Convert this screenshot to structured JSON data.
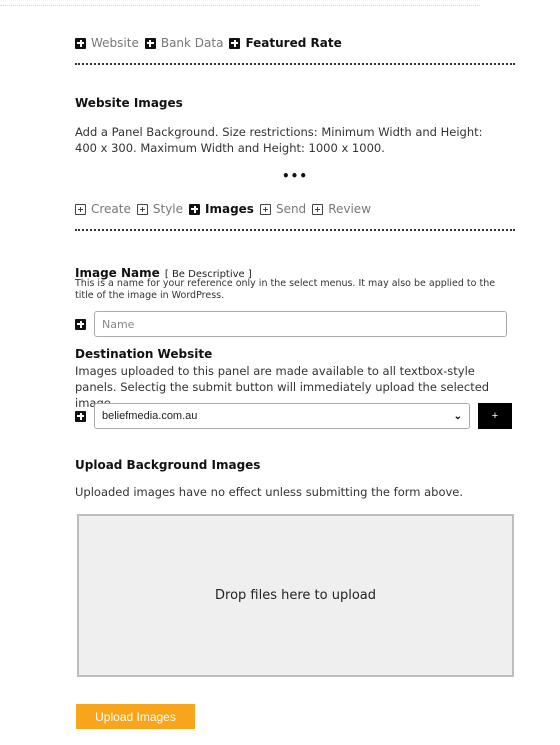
{
  "top_nav": {
    "items": [
      {
        "label": "Website",
        "active": false,
        "icon": "plus-square-solid-icon"
      },
      {
        "label": "Bank Data",
        "active": false,
        "icon": "plus-square-solid-icon"
      },
      {
        "label": "Featured Rate",
        "active": true,
        "icon": "plus-square-solid-icon"
      }
    ]
  },
  "website_images": {
    "title": "Website Images",
    "description": "Add a Panel Background. Size restrictions: Minimum Width and Height: 400 x 300. Maximum Width and Height: 1000 x 1000.",
    "more": "•••"
  },
  "step_nav": {
    "items": [
      {
        "label": "Create",
        "active": false,
        "icon": "plus-square-outline-icon"
      },
      {
        "label": "Style",
        "active": false,
        "icon": "plus-square-outline-icon"
      },
      {
        "label": "Images",
        "active": true,
        "icon": "plus-square-solid-icon"
      },
      {
        "label": "Send",
        "active": false,
        "icon": "plus-square-outline-icon"
      },
      {
        "label": "Review",
        "active": false,
        "icon": "plus-square-outline-icon"
      }
    ]
  },
  "image_name": {
    "label": "Image Name",
    "hint": "[ Be Descriptive ]",
    "help": "This is a name for your reference only in the select menus. It may also be applied to the title of the image in WordPress.",
    "value": "",
    "placeholder": "Name"
  },
  "destination": {
    "label": "Destination Website",
    "help": "Images uploaded to this panel are made available to all textbox-style panels. Selectig the submit button will immediately upload the selected image.",
    "selected": "beliefmedia.com.au",
    "add_label": "+"
  },
  "upload": {
    "title": "Upload Background Images",
    "help": "Uploaded images have no effect unless submitting the form above.",
    "dropzone_text": "Drop files here to upload",
    "button_label": "Upload Images",
    "button_color": "#f9a51c"
  }
}
